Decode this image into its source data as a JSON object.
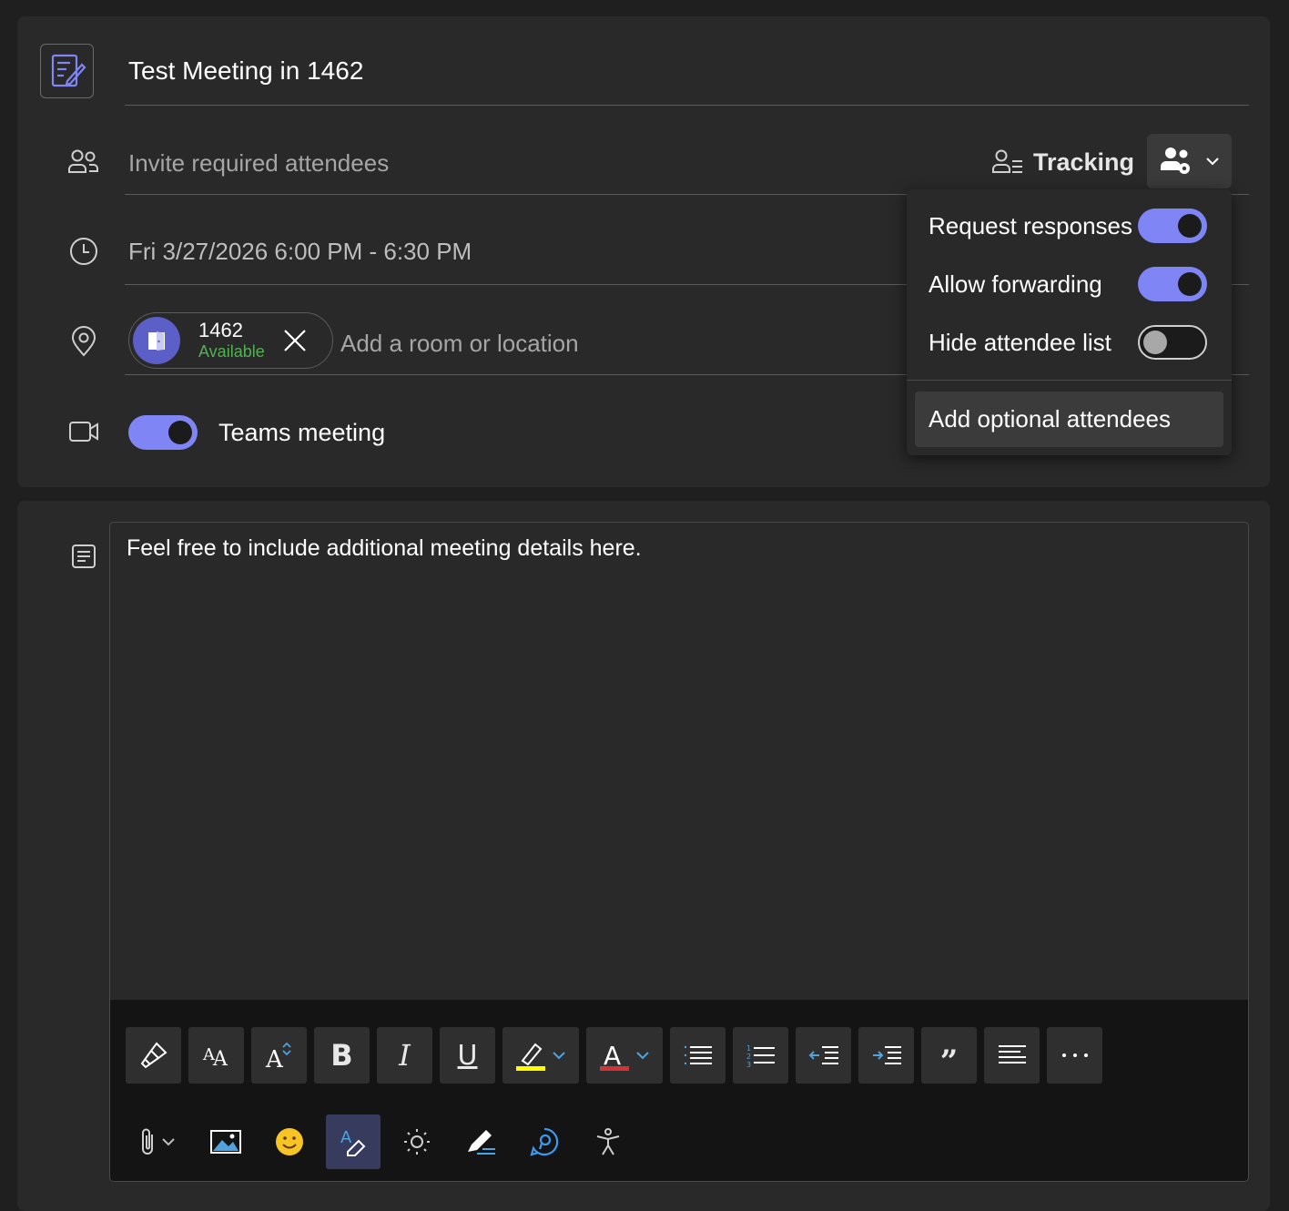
{
  "event": {
    "title": "Test Meeting in 1462",
    "attendees_placeholder": "Invite required attendees",
    "tracking_label": "Tracking",
    "datetime": "Fri 3/27/2026 6:00 PM - 6:30 PM",
    "location": {
      "room_name": "1462",
      "room_status": "Available",
      "placeholder": "Add a room or location"
    },
    "teams": {
      "label": "Teams meeting",
      "enabled": true
    }
  },
  "popup": {
    "options": [
      {
        "label": "Request responses",
        "on": true
      },
      {
        "label": "Allow forwarding",
        "on": true
      },
      {
        "label": "Hide attendee list",
        "on": false
      }
    ],
    "action": "Add optional attendees"
  },
  "body": {
    "text": "Feel free to include additional meeting details here."
  },
  "toolbar": {
    "row1": [
      "format-painter-icon",
      "font-size-icon",
      "grow-font-icon",
      "bold-icon",
      "italic-icon",
      "underline-icon",
      "highlight-icon",
      "font-color-icon",
      "bullets-icon",
      "numbering-icon",
      "decrease-indent-icon",
      "increase-indent-icon",
      "quote-icon",
      "align-icon",
      "more-icon"
    ],
    "row2": [
      "attach-icon",
      "picture-icon",
      "emoji-icon",
      "editor-icon",
      "brightness-icon",
      "draw-icon",
      "loop-icon",
      "accessibility-icon"
    ]
  },
  "colors": {
    "accent": "#7f85f5",
    "room_avatar": "#5b5fc7",
    "available": "#54b054",
    "highlight": "#ffff00",
    "font_color": "#d13438"
  }
}
